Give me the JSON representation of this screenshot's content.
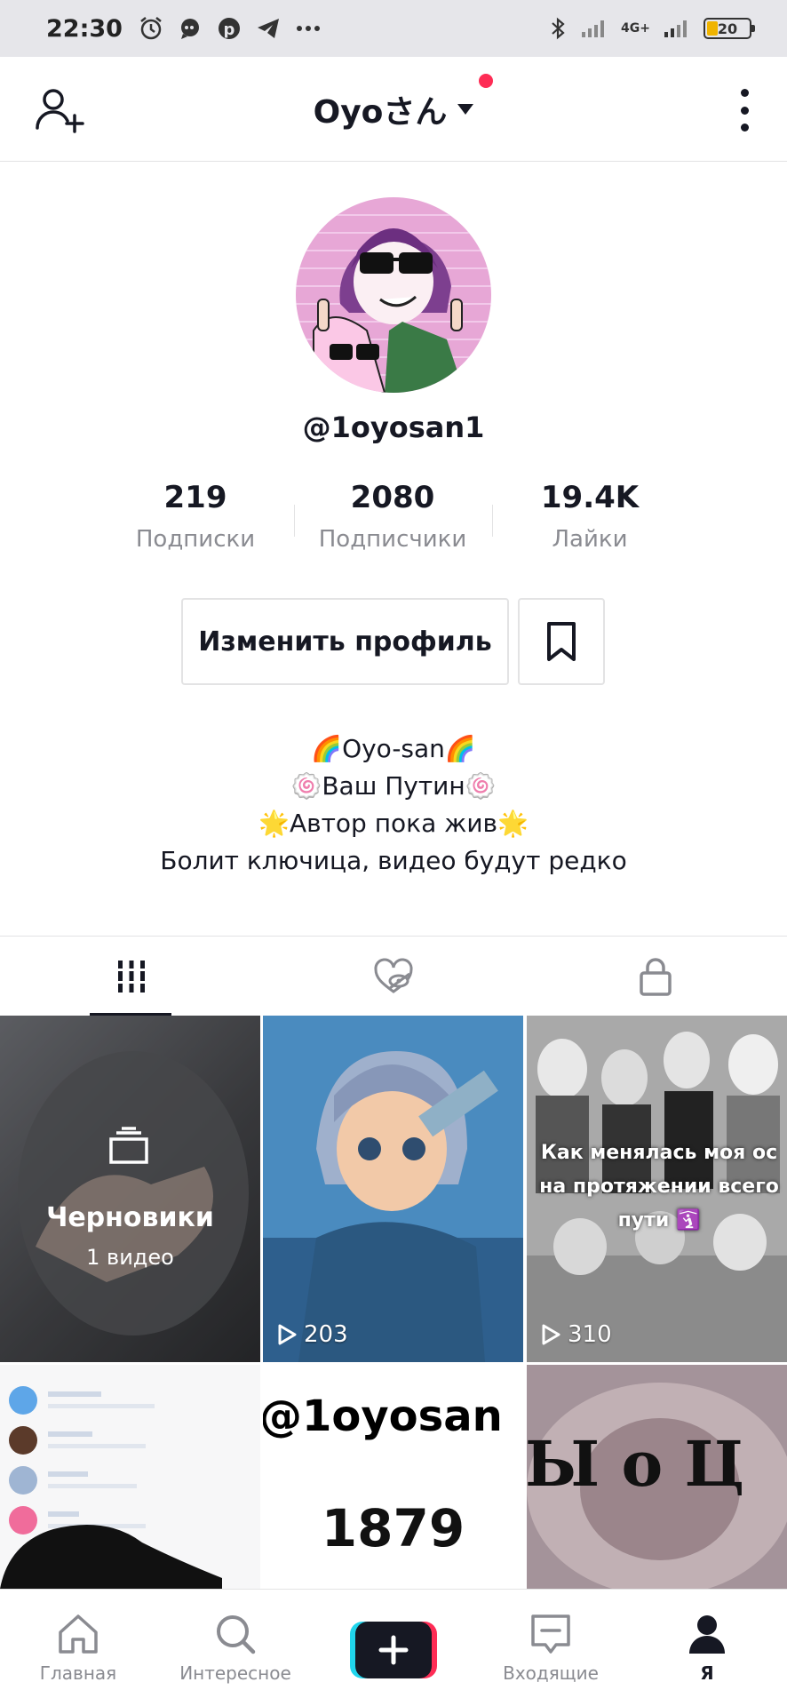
{
  "status_bar": {
    "time": "22:30",
    "network": "4G+",
    "battery": "20",
    "icons": [
      "alarm-icon",
      "chat-icon",
      "pinterest-icon",
      "telegram-icon",
      "more-dots-icon",
      "bluetooth-icon",
      "signal-icon",
      "battery-icon"
    ]
  },
  "header": {
    "title": "Oyoさん",
    "has_notification_dot": true,
    "accent": "#fe2c55"
  },
  "profile": {
    "username": "@1oyosan1",
    "stats": [
      {
        "value": "219",
        "label": "Подписки"
      },
      {
        "value": "2080",
        "label": "Подписчики"
      },
      {
        "value": "19.4K",
        "label": "Лайки"
      }
    ],
    "edit_button": "Изменить профиль",
    "bio": [
      "🌈Oyo-san🌈",
      "🍥Ваш Путин🍥",
      "🌟Автор пока жив🌟",
      "Болит ключица, видео будут редко"
    ]
  },
  "tabs": [
    {
      "icon": "grid-icon",
      "active": true
    },
    {
      "icon": "liked-hidden-icon",
      "active": false
    },
    {
      "icon": "lock-icon",
      "active": false
    }
  ],
  "videos": [
    {
      "type": "drafts",
      "title": "Черновики",
      "subtitle": "1 видео"
    },
    {
      "type": "video",
      "views": "203"
    },
    {
      "type": "video",
      "views": "310",
      "caption": "Как менялась моя ос на протяжении всего пути 🛐"
    },
    {
      "type": "video"
    },
    {
      "type": "video",
      "overlay_top": "@1oyosan",
      "overlay_bottom": "1879"
    },
    {
      "type": "video",
      "overlay": "Ы о Ц"
    }
  ],
  "bottom_nav": [
    {
      "label": "Главная",
      "icon": "home-icon",
      "active": false
    },
    {
      "label": "Интересное",
      "icon": "search-icon",
      "active": false
    },
    {
      "label": "",
      "icon": "plus-icon",
      "active": false
    },
    {
      "label": "Входящие",
      "icon": "inbox-icon",
      "active": false
    },
    {
      "label": "Я",
      "icon": "profile-icon",
      "active": true
    }
  ]
}
